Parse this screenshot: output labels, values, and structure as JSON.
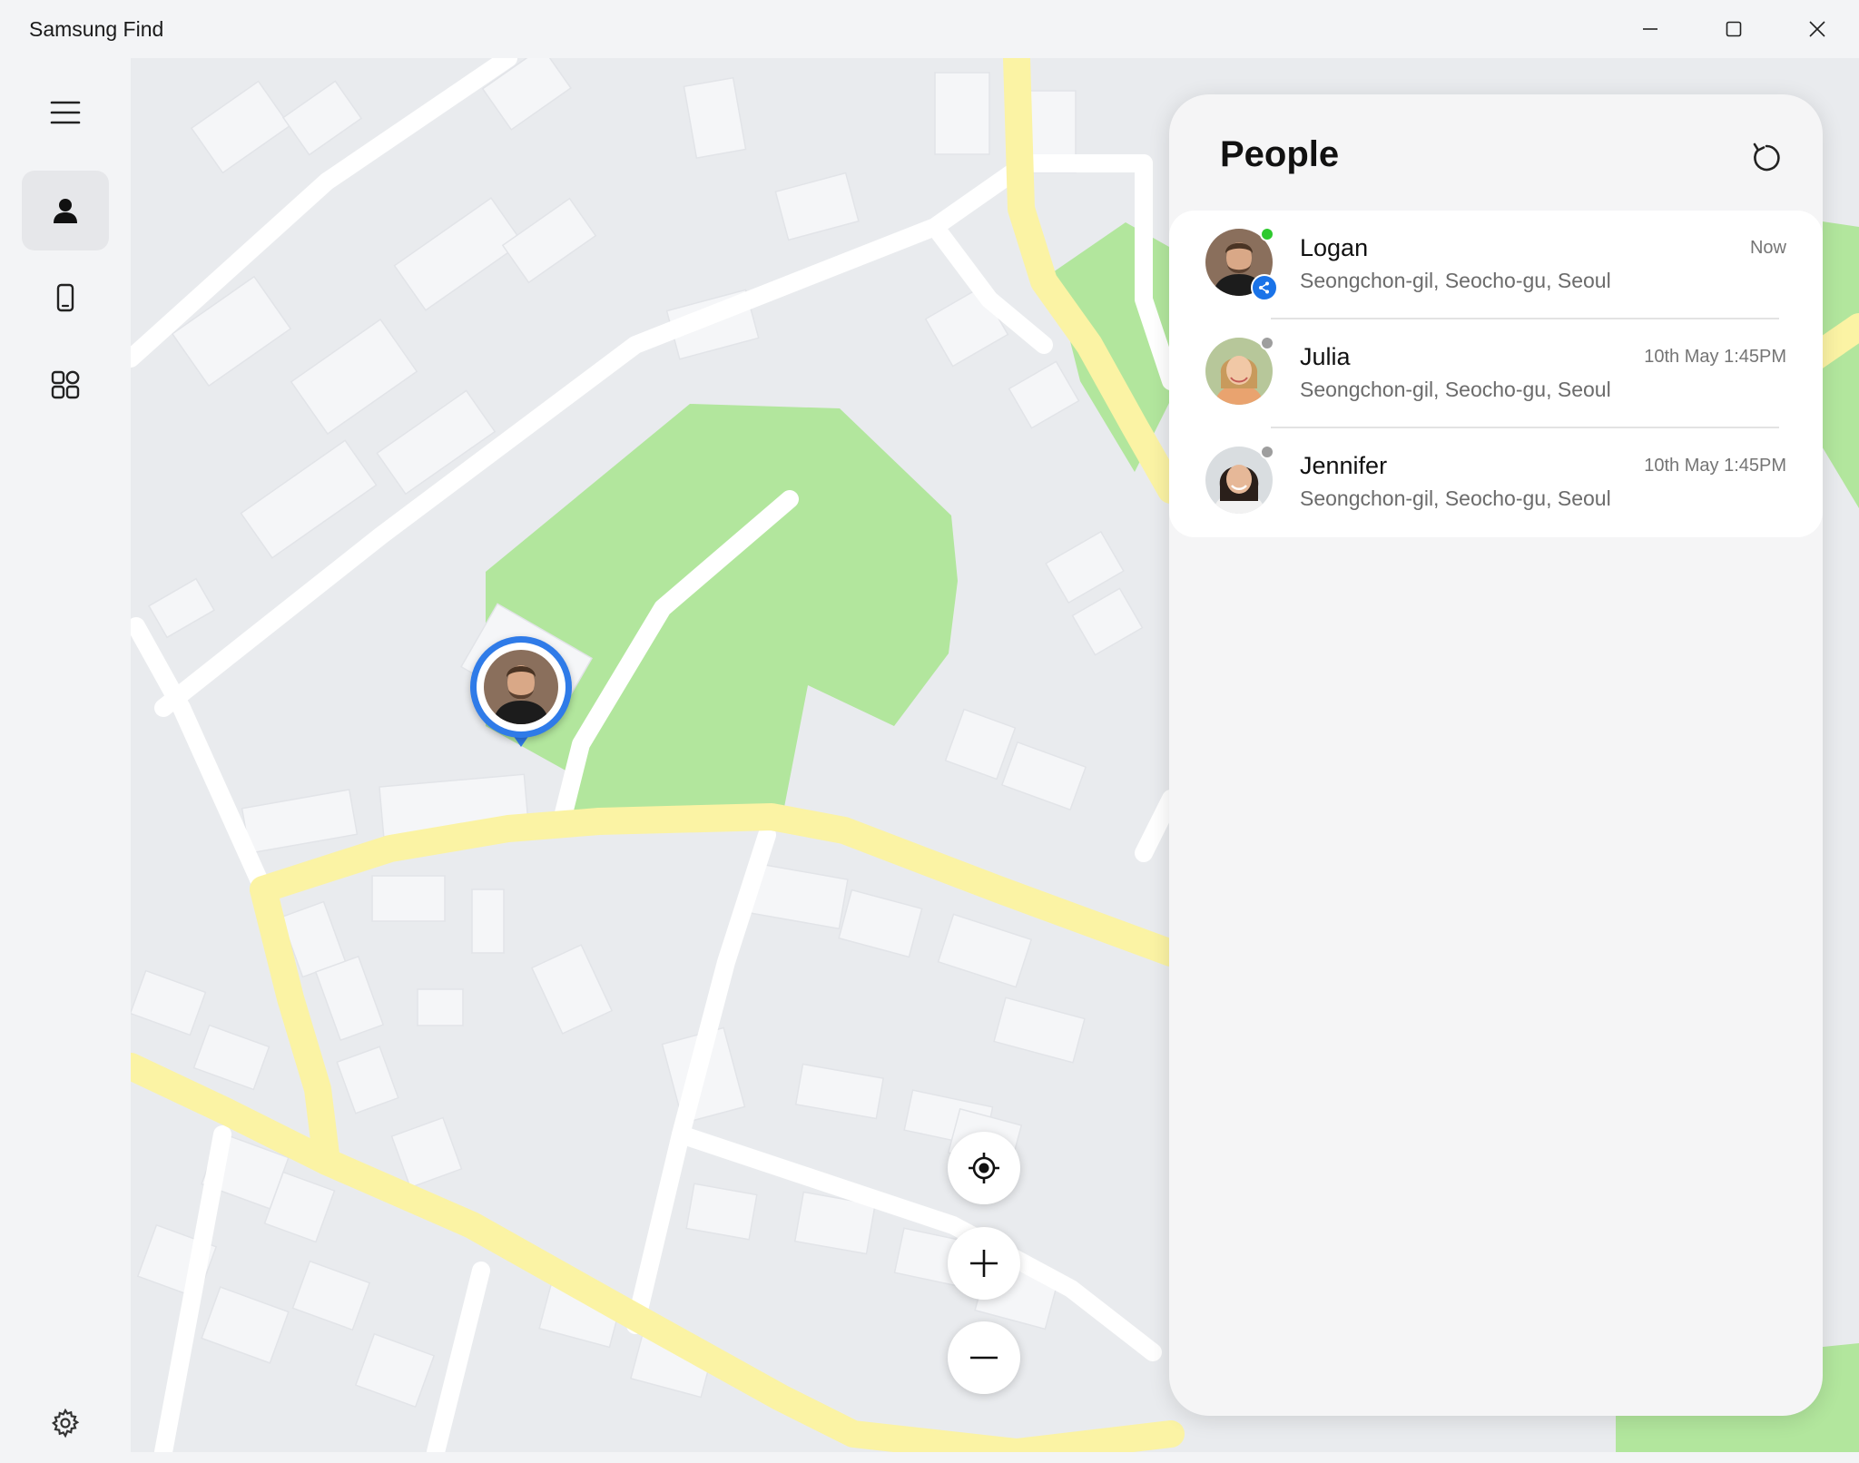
{
  "window": {
    "title": "Samsung Find",
    "controls": [
      "minimize-icon",
      "maximize-icon",
      "close-icon"
    ]
  },
  "rail": {
    "items": [
      {
        "name": "menu",
        "icon": "hamburger-icon"
      },
      {
        "name": "people",
        "icon": "person-icon",
        "active": true
      },
      {
        "name": "devices",
        "icon": "phone-icon"
      },
      {
        "name": "items",
        "icon": "grid-icon"
      }
    ],
    "settings_icon": "gear-icon"
  },
  "panel": {
    "title": "People",
    "refresh_icon": "refresh-icon",
    "people": [
      {
        "name": "Logan",
        "address": "Seongchon-gil, Seocho-gu, Seoul",
        "time": "Now",
        "status_color": "#2ec92e",
        "sharing": true
      },
      {
        "name": "Julia",
        "address": "Seongchon-gil, Seocho-gu, Seoul",
        "time": "10th May 1:45PM",
        "status_color": "#9e9e9e",
        "sharing": false
      },
      {
        "name": "Jennifer",
        "address": "Seongchon-gil, Seocho-gu, Seoul",
        "time": "10th May 1:45PM",
        "status_color": "#9e9e9e",
        "sharing": false
      }
    ]
  },
  "map": {
    "controls": [
      "my-location-icon",
      "zoom-in-icon",
      "zoom-out-icon"
    ],
    "colors": {
      "background": "#e9ebee",
      "building": "#f5f6f8",
      "road": "#ffffff",
      "main_road": "#fbf3a4",
      "park": "#b2e69d"
    }
  },
  "colors": {
    "accent": "#2f7be8",
    "online": "#2ec92e",
    "offline": "#9e9e9e"
  }
}
